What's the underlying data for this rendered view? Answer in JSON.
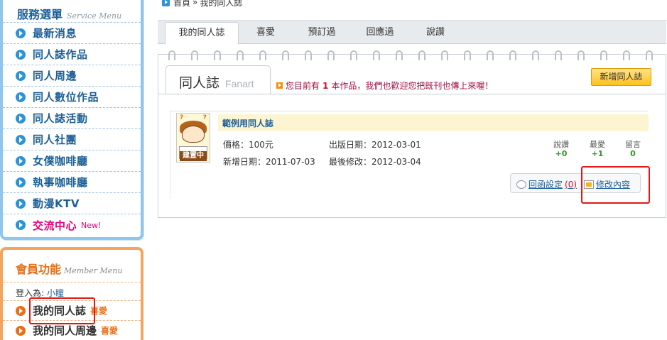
{
  "breadcrumb": {
    "home": "首頁",
    "sep": "»",
    "current": "我的同人誌"
  },
  "service_menu": {
    "title": "服務選單",
    "title_en": "Service Menu",
    "items": [
      {
        "label": "最新消息"
      },
      {
        "label": "同人誌作品"
      },
      {
        "label": "同人周邊"
      },
      {
        "label": "同人數位作品"
      },
      {
        "label": "同人誌活動"
      },
      {
        "label": "同人社團"
      },
      {
        "label": "女僕咖啡廳"
      },
      {
        "label": "執事咖啡廳"
      },
      {
        "label": "動漫KTV"
      },
      {
        "label": "交流中心",
        "badge": "New!"
      }
    ]
  },
  "member_menu": {
    "title": "會員功能",
    "title_en": "Member Menu",
    "login_label": "登入為:",
    "username": "小瞳",
    "items": [
      {
        "label": "我的同人誌",
        "sub": "喜愛"
      },
      {
        "label": "我的同人周邊",
        "sub": "喜愛"
      }
    ]
  },
  "tabs": [
    {
      "label": "我的同人誌",
      "active": true
    },
    {
      "label": "喜愛",
      "active": false
    },
    {
      "label": "預訂過",
      "active": false
    },
    {
      "label": "回應過",
      "active": false
    },
    {
      "label": "說讚",
      "active": false
    }
  ],
  "panel": {
    "tab_title": "同人誌",
    "tab_title_en": "Fanart",
    "notice_prefix": "您目前有",
    "notice_count": "1",
    "notice_suffix": "本作品，我們也歡迎您把既刊也傳上來喔！",
    "add_button": "新增同人誌"
  },
  "work": {
    "title": "範例用同人誌",
    "thumb_tag": "建置中",
    "price_label": "價格：",
    "price": "100元",
    "publish_label": "出版日期：",
    "publish_date": "2012-03-01",
    "added_label": "新增日期：",
    "added_date": "2011-07-03",
    "modified_label": "最後修改：",
    "modified_date": "2012-03-04",
    "stats": [
      {
        "label": "說讚",
        "value": "+0"
      },
      {
        "label": "最愛",
        "value": "+1"
      },
      {
        "label": "留言",
        "value": "0"
      }
    ],
    "reply_settings": "回函設定",
    "reply_count": "(0)",
    "edit": "修改內容"
  },
  "colors": {
    "service_border": "#8fc6ee",
    "service_text": "#1c5f97",
    "member_border": "#f6a35e",
    "member_accent": "#ea6e15",
    "highlight_pink": "#e6007a",
    "annotation_red": "#e01818",
    "stat_green": "#2a9a24",
    "button_yellow": "#ffc21c"
  }
}
